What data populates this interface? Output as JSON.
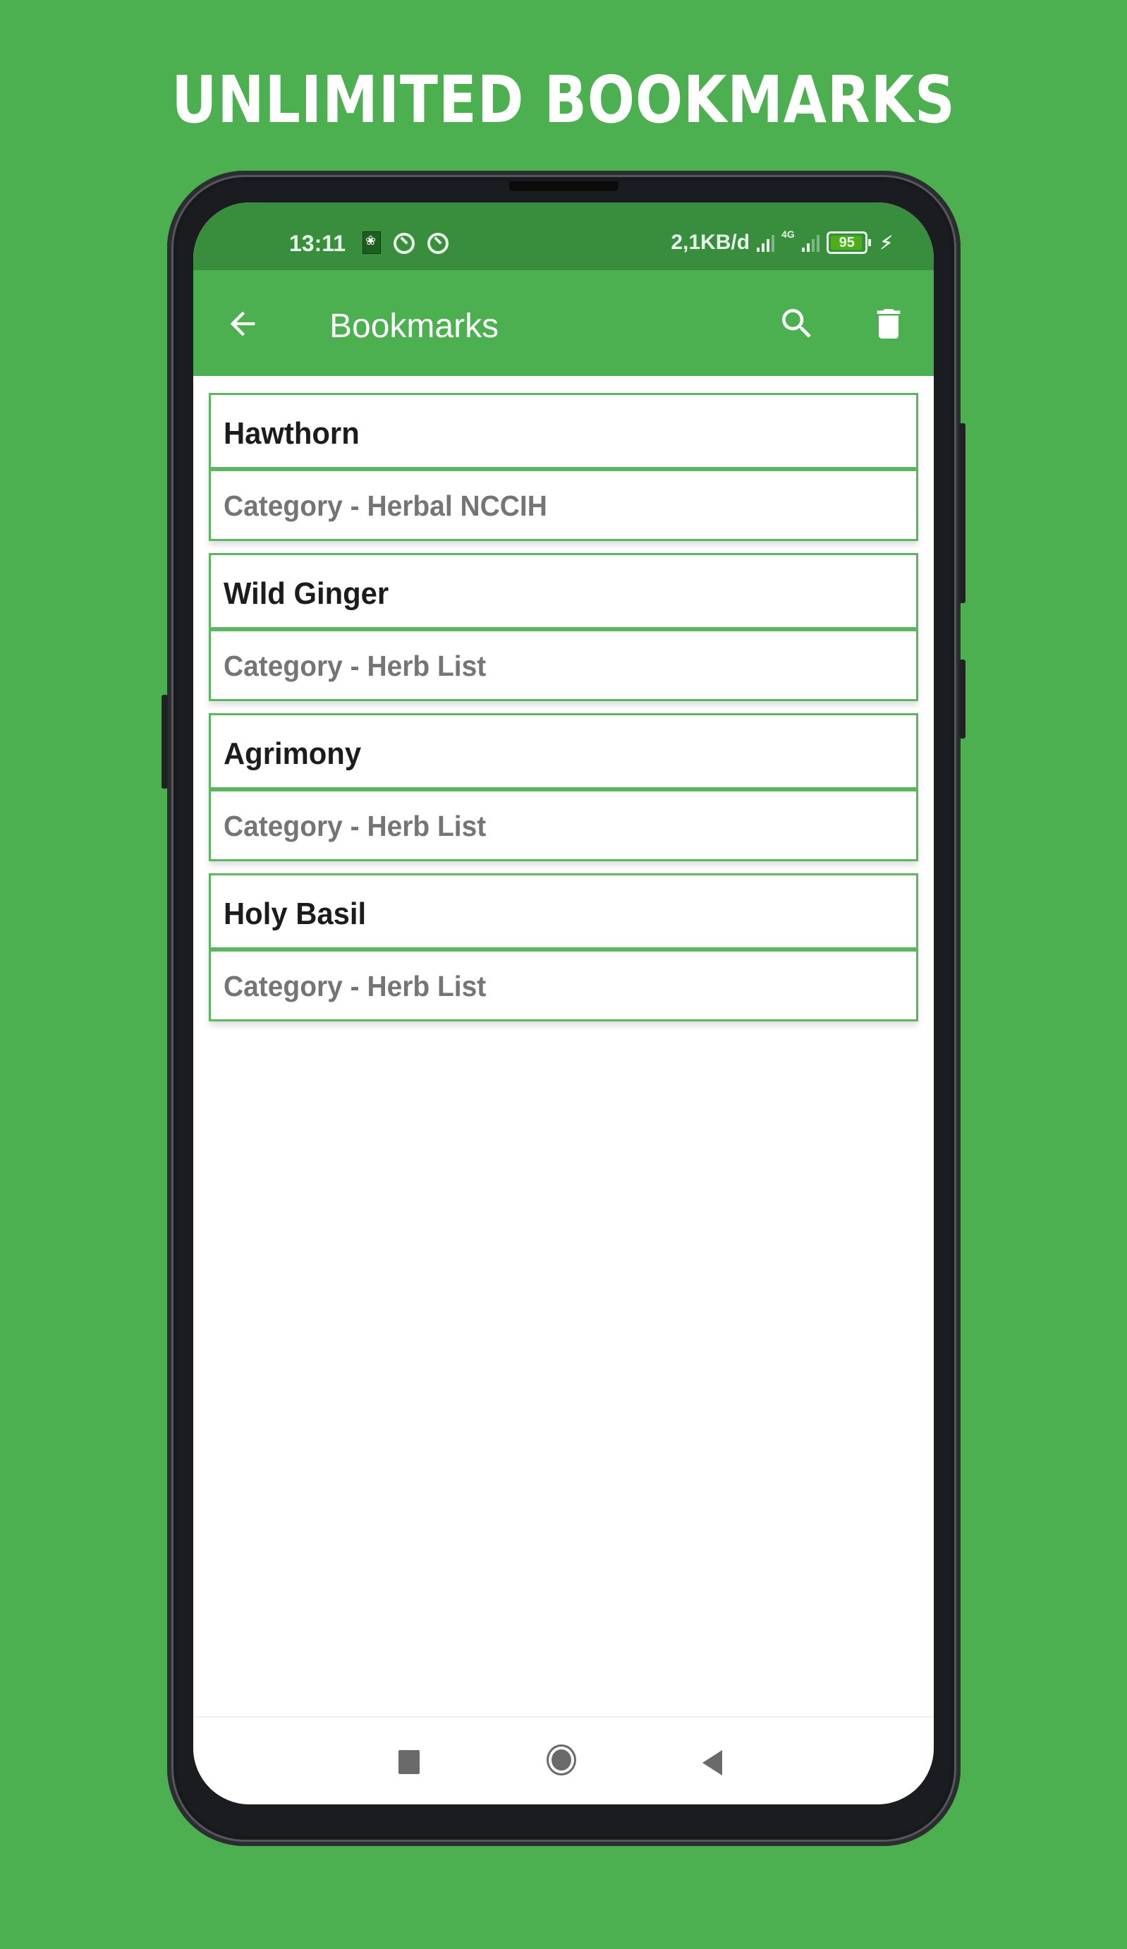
{
  "banner": {
    "headline": "UNLIMITED BOOKMARKS"
  },
  "status_bar": {
    "time": "13:11",
    "data_rate": "2,1KB/d",
    "network_type": "4G",
    "battery_percent": "95",
    "icons": [
      "herb-app-notification-icon",
      "q-notification-icon",
      "q-notification-icon",
      "signal-icon",
      "signal-4g-icon",
      "battery-icon",
      "charging-bolt-icon"
    ]
  },
  "app_bar": {
    "title": "Bookmarks",
    "back_icon": "arrow-left-icon",
    "actions": [
      {
        "name": "search",
        "icon": "search-icon"
      },
      {
        "name": "delete-all",
        "icon": "trash-icon"
      }
    ],
    "color": "#4caf50",
    "status_color": "#388e3c"
  },
  "bookmarks": [
    {
      "name": "Hawthorn",
      "category": "Category - Herbal NCCIH"
    },
    {
      "name": "Wild Ginger",
      "category": "Category - Herb List"
    },
    {
      "name": "Agrimony",
      "category": "Category - Herb List"
    },
    {
      "name": "Holy Basil",
      "category": "Category - Herb List"
    }
  ],
  "nav_bar": {
    "buttons": [
      "recent-apps",
      "home",
      "back"
    ]
  }
}
